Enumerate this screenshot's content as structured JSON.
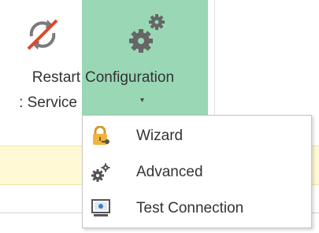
{
  "ribbon": {
    "restart": {
      "label_line1": "Restart",
      "label_line2": ": Service",
      "icon": "restart-service-icon"
    },
    "configuration": {
      "label": "Configuration",
      "dropdown_arrow": "▾",
      "icon": "gears-icon",
      "active_color": "#99d7b5"
    }
  },
  "dropdown_menu": {
    "items": [
      {
        "label": "Wizard",
        "icon": "lock-key-icon"
      },
      {
        "label": "Advanced",
        "icon": "gears-small-icon"
      },
      {
        "label": "Test Connection",
        "icon": "test-connection-icon"
      }
    ]
  },
  "colors": {
    "info_bar": "#fff9d6",
    "accent_red": "#e0452b"
  }
}
